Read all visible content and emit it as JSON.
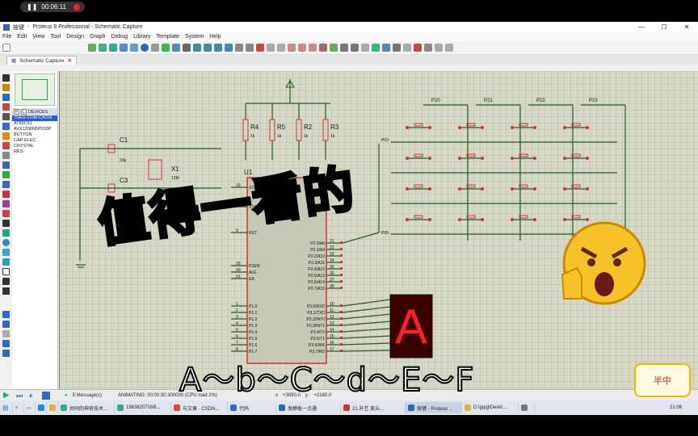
{
  "window": {
    "title": "Proteus 8 Professional - Schematic Capture",
    "title_prefix": "按键"
  },
  "timer": {
    "time": "00:06:11"
  },
  "menu": [
    "File",
    "Edit",
    "View",
    "Tool",
    "Design",
    "Graph",
    "Debug",
    "Library",
    "Template",
    "System",
    "Help"
  ],
  "tab": {
    "label": "Schematic Capture"
  },
  "devices": {
    "header": "DEVICES",
    "p_label": "P",
    "l_label": "L",
    "items": [
      "7SEG-COM-CATHI",
      "AT89C51",
      "AVX1206N5P033P",
      "BUTTON",
      "CAP-ELEC",
      "CRYSTAL",
      "RES"
    ]
  },
  "schematic": {
    "resistors": [
      {
        "ref": "R4",
        "val": "1k"
      },
      {
        "ref": "R5",
        "val": "1k"
      },
      {
        "ref": "R2",
        "val": "1k"
      },
      {
        "ref": "R3",
        "val": "1k"
      }
    ],
    "caps": [
      {
        "ref": "C1",
        "val": "33p"
      },
      {
        "ref": "C3",
        "val": "33p"
      }
    ],
    "crystal": {
      "ref": "X1",
      "val": "12M"
    },
    "mcu": {
      "ref": "U1"
    },
    "mcu_left_pins": [
      {
        "num": "19",
        "name": "XTAL1"
      },
      {
        "num": "18",
        "name": "XTAL2"
      },
      {
        "num": "9",
        "name": "RST"
      },
      {
        "num": "29",
        "name": "PSEN"
      },
      {
        "num": "30",
        "name": "ALE"
      },
      {
        "num": "31",
        "name": "EA"
      },
      {
        "num": "1",
        "name": "P1.0"
      },
      {
        "num": "2",
        "name": "P1.1"
      },
      {
        "num": "3",
        "name": "P1.2"
      },
      {
        "num": "4",
        "name": "P1.3"
      },
      {
        "num": "5",
        "name": "P1.4"
      },
      {
        "num": "6",
        "name": "P1.5"
      },
      {
        "num": "7",
        "name": "P1.6"
      },
      {
        "num": "8",
        "name": "P1.7"
      }
    ],
    "mcu_right_pins": [
      {
        "num": "21",
        "name": "P2.0/A8"
      },
      {
        "num": "22",
        "name": "P2.1/A9"
      },
      {
        "num": "23",
        "name": "P2.2/A10"
      },
      {
        "num": "24",
        "name": "P2.3/A11"
      },
      {
        "num": "25",
        "name": "P2.4/A12"
      },
      {
        "num": "26",
        "name": "P2.5/A13"
      },
      {
        "num": "27",
        "name": "P2.6/A14"
      },
      {
        "num": "28",
        "name": "P2.7/A15"
      },
      {
        "num": "10",
        "name": "P3.0/RXD"
      },
      {
        "num": "11",
        "name": "P3.1/TXD"
      },
      {
        "num": "12",
        "name": "P3.2/INT0"
      },
      {
        "num": "13",
        "name": "P3.3/INT1"
      },
      {
        "num": "14",
        "name": "P3.4/T0"
      },
      {
        "num": "15",
        "name": "P3.5/T1"
      },
      {
        "num": "16",
        "name": "P3.6/WR"
      },
      {
        "num": "17",
        "name": "P3.7/RD"
      }
    ],
    "col_labels": [
      "P20",
      "P21",
      "P22",
      "P23"
    ],
    "row_labels": [
      "P03",
      "P00"
    ],
    "display_digit": "A",
    "colors": {
      "wire": "#1f5f1f",
      "component": "#c33",
      "chip": "#c8c8b6",
      "segment_on": "#ff2020",
      "segment_bg": "#3a0000"
    }
  },
  "statusbar": {
    "messages": "5 Message(s)",
    "animating": "ANIMATING: 00:00:30.300000 (CPU load 2%)",
    "x": "+3050.0",
    "y": "+2160.0",
    "x_label": "x",
    "y_label": "y:"
  },
  "taskbar": {
    "items": [
      "共同的神奇技术...",
      "1983820716B...",
      "与文章 · CSDN...",
      "代码",
      "发酵板一点通",
      "21.补艺 美丘...",
      "按键 - Proteus ...",
      "D:\\gqqj\\Deskt...",
      ""
    ],
    "time": "21:06"
  },
  "overlay": {
    "banner": "值得一看的",
    "caption": "A～b～C～d～E～F",
    "badge": "半中"
  }
}
